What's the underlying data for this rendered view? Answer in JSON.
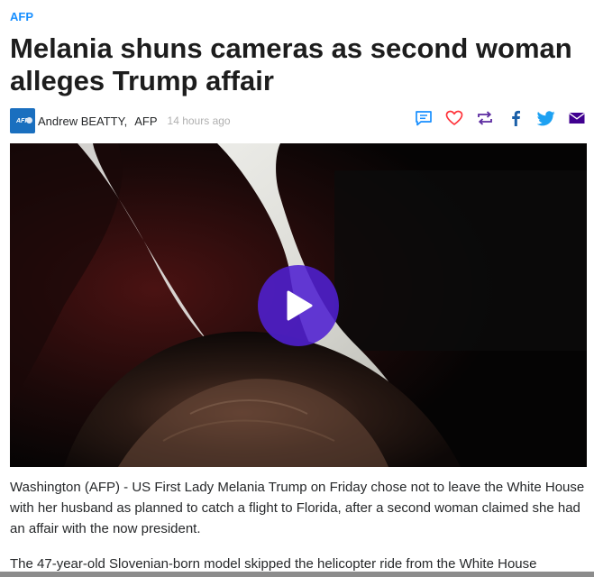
{
  "source": {
    "label": "AFP"
  },
  "article": {
    "headline": "Melania shuns cameras as second woman alleges Trump affair",
    "author": "Andrew BEATTY,",
    "provider": "AFP",
    "timestamp": "14 hours ago",
    "paragraphs": [
      "Washington (AFP) - US First Lady Melania Trump on Friday chose not to leave the White House with her husband as planned to catch a flight to Florida, after a second woman claimed she had an affair with the now president.",
      "The 47-year-old Slovenian-born model skipped the helicopter ride from the White House"
    ]
  },
  "provider_logo": {
    "text": "AFP",
    "color": "#1a6fbf"
  },
  "share_actions": [
    {
      "name": "comments-icon",
      "color": "#188fff"
    },
    {
      "name": "heart-icon",
      "color": "#ff333a"
    },
    {
      "name": "retweet-icon",
      "color": "#5b2aa0"
    },
    {
      "name": "facebook-icon",
      "color": "#1a5fa8"
    },
    {
      "name": "twitter-icon",
      "color": "#1da1f2"
    },
    {
      "name": "mail-icon",
      "color": "#400090"
    }
  ],
  "video": {
    "play_color": "#5020d2"
  },
  "colors": {
    "accent": "#188fff",
    "text": "#26282a",
    "muted": "#b0b0b0"
  }
}
